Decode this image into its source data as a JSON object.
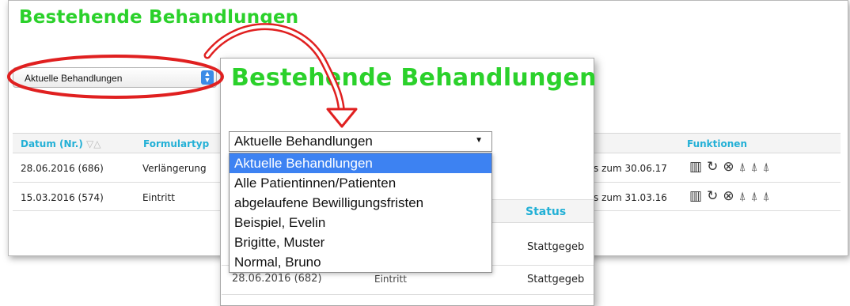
{
  "background": {
    "title": "Bestehende Behandlungen",
    "select_value": "Aktuelle Behandlungen",
    "table": {
      "headers": {
        "date": "Datum (Nr.)",
        "form_type": "Formulartyp",
        "functions": "Funktionen"
      },
      "rows": [
        {
          "date": "28.06.2016 (686)",
          "form_type": "Verlängerung",
          "validity": "s zum 30.06.17"
        },
        {
          "date": "15.03.2016 (574)",
          "form_type": "Eintritt",
          "validity": "s zum 31.03.16"
        }
      ]
    }
  },
  "overlay": {
    "title": "Bestehende Behandlungen",
    "select_value": "Aktuelle Behandlungen",
    "options": [
      "Aktuelle Behandlungen",
      "Alle Patientinnen/Patienten",
      "abgelaufene Bewilligungsfristen",
      "Beispiel, Evelin",
      "Brigitte, Muster",
      "Normal, Bruno"
    ],
    "selected_index": 0,
    "status_header": "Status",
    "rows": [
      {
        "status": "Stattgegeb"
      },
      {
        "date": "28.06.2016 (682)",
        "form_type": "Eintritt",
        "status": "Stattgegeb"
      }
    ]
  },
  "annotation": {
    "color": "#e02020"
  },
  "colors": {
    "title_green": "#2bd12b",
    "header_blue": "#23b0d6",
    "selection_blue": "#3d82f2"
  },
  "icons": [
    "chart-icon",
    "refresh-icon",
    "cancel-icon",
    "pdf-icon",
    "pdf-icon",
    "pdf-icon"
  ]
}
